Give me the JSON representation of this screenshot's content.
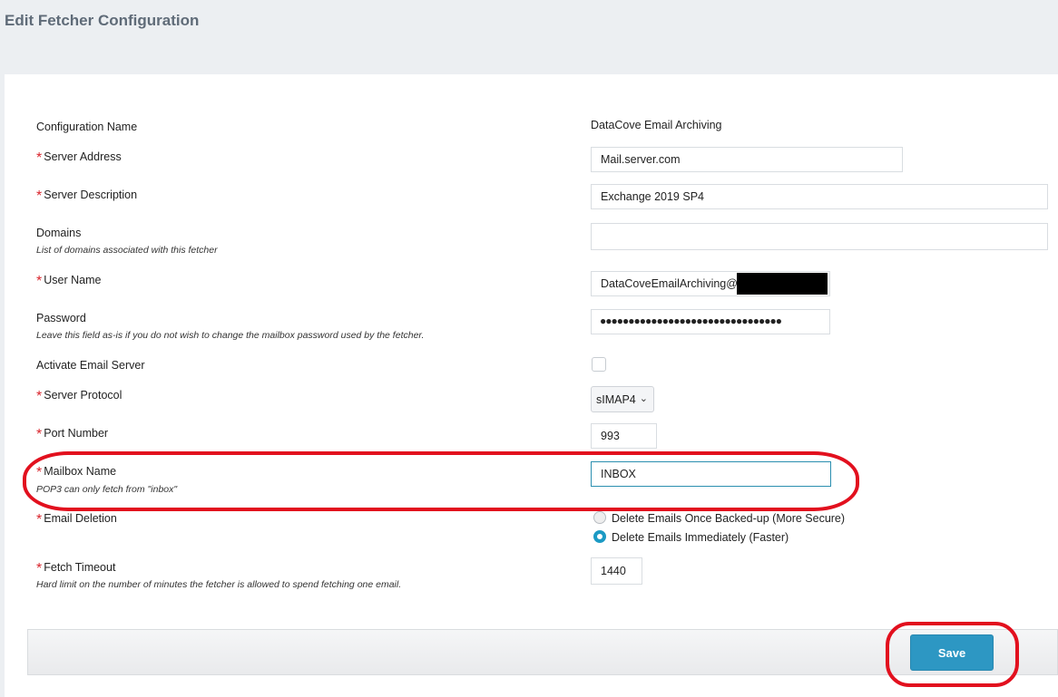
{
  "page": {
    "title": "Edit Fetcher Configuration"
  },
  "form": {
    "config_name": {
      "label": "Configuration Name",
      "value": "DataCove Email Archiving"
    },
    "server_address": {
      "label": "Server Address",
      "value": "Mail.server.com"
    },
    "server_description": {
      "label": "Server Description",
      "value": "Exchange 2019 SP4"
    },
    "domains": {
      "label": "Domains",
      "help": "List of domains associated with this fetcher",
      "value": ""
    },
    "user_name": {
      "label": "User Name",
      "value": "DataCoveEmailArchiving@"
    },
    "password": {
      "label": "Password",
      "help": "Leave this field as-is if you do not wish to change the mailbox password used by the fetcher.",
      "value": "●●●●●●●●●●●●●●●●●●●●●●●●●●●●●●●●"
    },
    "activate_email_server": {
      "label": "Activate Email Server",
      "checked": false
    },
    "server_protocol": {
      "label": "Server Protocol",
      "value": "sIMAP4"
    },
    "port_number": {
      "label": "Port Number",
      "value": "993"
    },
    "mailbox_name": {
      "label": "Mailbox Name",
      "help": "POP3 can only fetch from \"inbox\"",
      "value": "INBOX"
    },
    "email_deletion": {
      "label": "Email Deletion",
      "options": [
        {
          "label": "Delete Emails Once Backed-up (More Secure)",
          "selected": false
        },
        {
          "label": "Delete Emails Immediately (Faster)",
          "selected": true
        }
      ]
    },
    "fetch_timeout": {
      "label": "Fetch Timeout",
      "help": "Hard limit on the number of minutes the fetcher is allowed to spend fetching one email.",
      "value": "1440"
    }
  },
  "footer": {
    "save_label": "Save"
  },
  "required_mark": "*",
  "icons": {
    "chevron": "chevron-down-icon"
  },
  "colors": {
    "accent": "#2d97c3",
    "required": "#d9262e",
    "annotation": "#e2101e"
  }
}
